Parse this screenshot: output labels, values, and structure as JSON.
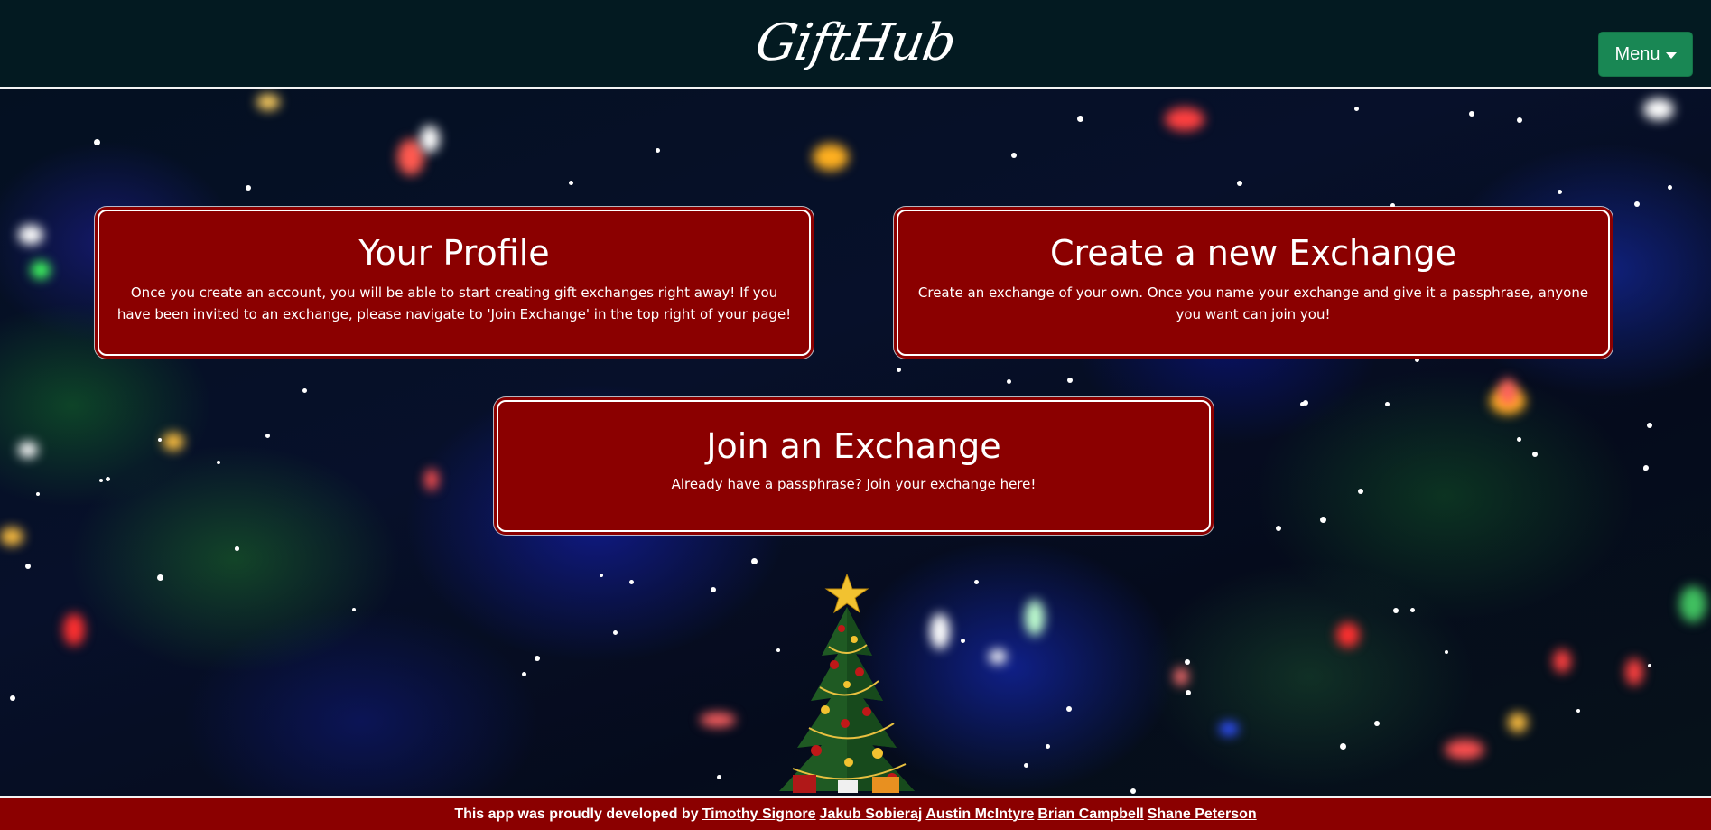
{
  "header": {
    "brand": "GiftHub",
    "menu_label": "Menu"
  },
  "cards": {
    "profile": {
      "title": "Your Profile",
      "text": "Once you create an account, you will be able to start creating gift exchanges right away! If you have been invited to an exchange, please navigate to 'Join Exchange' in the top right of your page!"
    },
    "create": {
      "title": "Create a new Exchange",
      "text": "Create an exchange of your own. Once you name your exchange and give it a passphrase, anyone you want can join you!"
    },
    "join": {
      "title": "Join an Exchange",
      "text": "Already have a passphrase? Join your exchange here!"
    }
  },
  "footer": {
    "intro": "This app was proudly developed by",
    "developers": [
      "Timothy Signore",
      "Jakub Sobieraj",
      "Austin McIntyre",
      "Brian Campbell",
      "Shane Peterson"
    ]
  },
  "colors": {
    "header_bg": "#031a21",
    "card_bg": "#8b0000",
    "menu_button": "#198754",
    "footer_bg": "#8b0000"
  },
  "icons": {
    "menu_caret": "caret-down-icon",
    "tree": "christmas-tree-icon"
  }
}
